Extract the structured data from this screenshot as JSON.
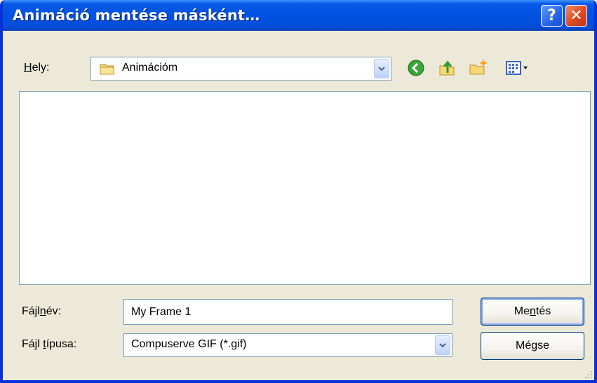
{
  "window": {
    "title": "Animáció mentése másként…",
    "help_glyph": "?",
    "close_glyph": "✕"
  },
  "location": {
    "label_prefix": "",
    "label_mnemonic": "H",
    "label_rest": "ely:",
    "value": "Animációm",
    "icon": "folder-icon"
  },
  "toolbar": {
    "icons": [
      "back-icon",
      "up-folder-icon",
      "new-folder-icon",
      "view-menu-icon"
    ]
  },
  "file_list": {
    "items": []
  },
  "filename": {
    "label_prefix": "Fájl",
    "label_mnemonic": "n",
    "label_rest": "év:",
    "value": "My Frame 1"
  },
  "filetype": {
    "label_prefix": "Fájl ",
    "label_mnemonic": "t",
    "label_rest": "ípusa:",
    "value": "Compuserve GIF (*.gif)"
  },
  "buttons": {
    "save_prefix": "Me",
    "save_mnemonic": "n",
    "save_rest": "tés",
    "cancel": "Mégse"
  },
  "colors": {
    "titlebar": "#0054e3",
    "window_bg": "#ece9d8",
    "border": "#0831d9",
    "close": "#de4a22"
  }
}
